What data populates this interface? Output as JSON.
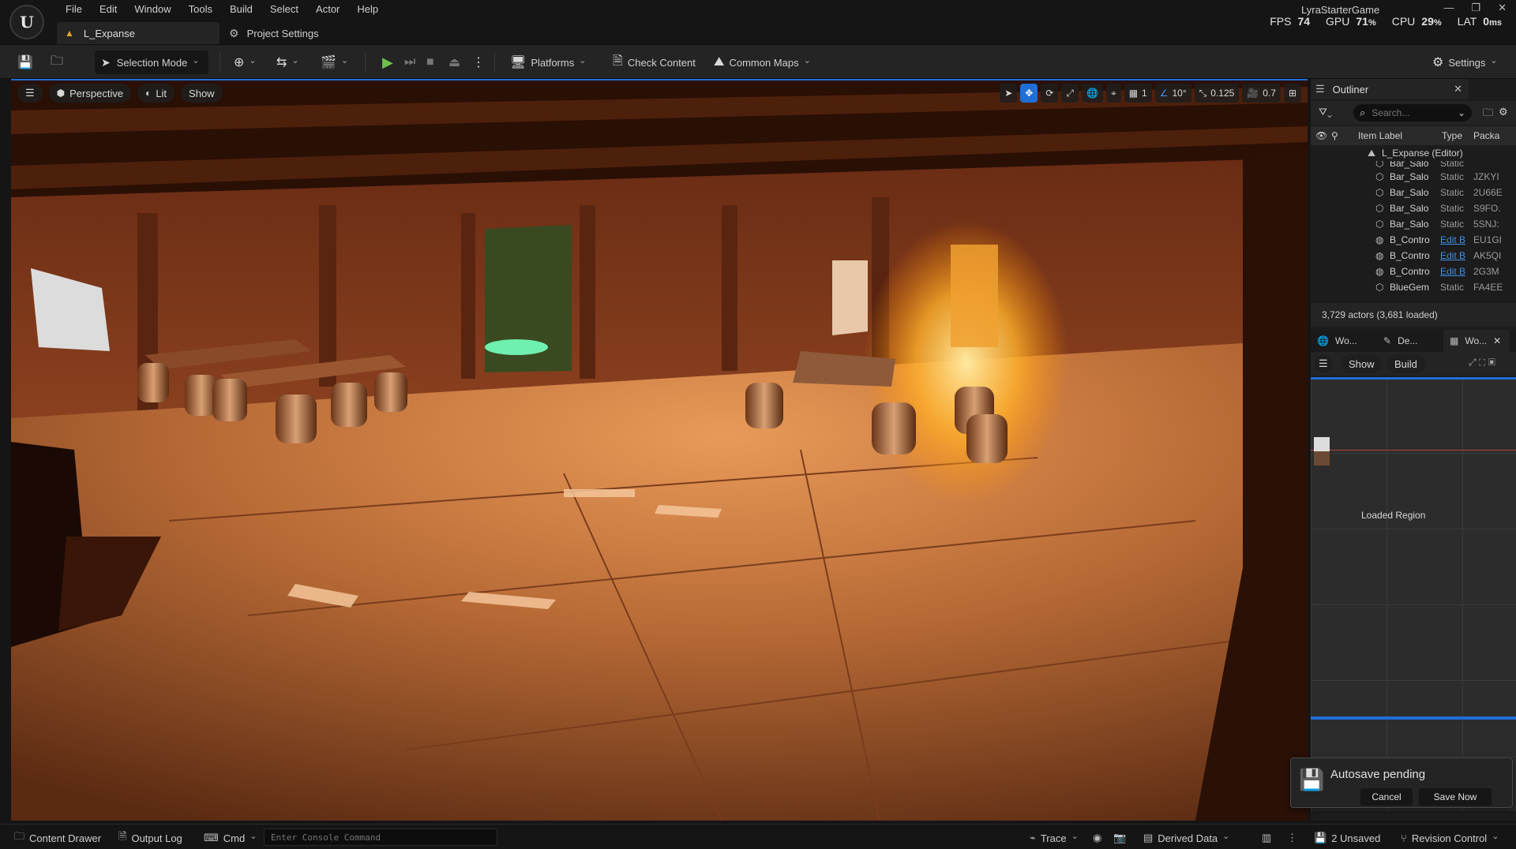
{
  "app": {
    "logo": "ue-logo",
    "project_name": "LyraStarterGame",
    "menus": [
      "File",
      "Edit",
      "Window",
      "Tools",
      "Build",
      "Select",
      "Actor",
      "Help"
    ],
    "doc_tab": "L_Expanse",
    "project_settings_tab": "Project Settings",
    "window_controls": [
      "—",
      "❐",
      "✕"
    ]
  },
  "perf": {
    "fps_label": "FPS",
    "fps_value": "74",
    "gpu_label": "GPU",
    "gpu_value": "71",
    "gpu_unit": "%",
    "cpu_label": "CPU",
    "cpu_value": "29",
    "cpu_unit": "%",
    "lat_label": "LAT",
    "lat_value": "0",
    "lat_unit": "ms"
  },
  "toolbar": {
    "selection_mode": "Selection Mode",
    "platforms": "Platforms",
    "check_content": "Check Content",
    "common_maps": "Common Maps",
    "settings": "Settings"
  },
  "viewport": {
    "perspective": "Perspective",
    "lit": "Lit",
    "show": "Show",
    "grid_snap": "1",
    "angle_snap": "10°",
    "scale_snap": "0.125",
    "camera_speed": "0.7"
  },
  "outliner": {
    "tab_title": "Outliner",
    "search_placeholder": "Search...",
    "columns": {
      "label": "Item Label",
      "type": "Type",
      "package": "Packa"
    },
    "root": "L_Expanse (Editor)",
    "rows": [
      {
        "label": "Bar_Salo",
        "type": "Static",
        "pkg": "",
        "icon": "static-mesh-icon",
        "partial": true
      },
      {
        "label": "Bar_Salo",
        "type": "Static",
        "pkg": "JZKYI",
        "icon": "static-mesh-icon"
      },
      {
        "label": "Bar_Salo",
        "type": "Static",
        "pkg": "2U66E",
        "icon": "static-mesh-icon"
      },
      {
        "label": "Bar_Salo",
        "type": "Static",
        "pkg": "S9FO.",
        "icon": "static-mesh-icon"
      },
      {
        "label": "Bar_Salo",
        "type": "Static",
        "pkg": "5SNJ:",
        "icon": "static-mesh-icon"
      },
      {
        "label": "B_Contro",
        "type": "Edit B",
        "pkg": "EU1GI",
        "icon": "blueprint-icon",
        "link": true
      },
      {
        "label": "B_Contro",
        "type": "Edit B",
        "pkg": "AK5QI",
        "icon": "blueprint-icon",
        "link": true
      },
      {
        "label": "B_Contro",
        "type": "Edit B",
        "pkg": "2G3M",
        "icon": "blueprint-icon",
        "link": true
      },
      {
        "label": "BlueGem",
        "type": "Static",
        "pkg": "FA4EE",
        "icon": "static-mesh-icon"
      }
    ],
    "status": "3,729 actors (3,681 loaded)"
  },
  "world_partition": {
    "tabs": [
      "Wo...",
      "De...",
      "Wo..."
    ],
    "show": "Show",
    "build": "Build",
    "region_label": "Loaded Region"
  },
  "autosave": {
    "title": "Autosave pending",
    "cancel": "Cancel",
    "save_now": "Save Now"
  },
  "statusbar": {
    "content_drawer": "Content Drawer",
    "output_log": "Output Log",
    "cmd": "Cmd",
    "console_placeholder": "Enter Console Command",
    "trace": "Trace",
    "derived_data": "Derived Data",
    "unsaved": "2 Unsaved",
    "revision_control": "Revision Control"
  },
  "colors": {
    "accent": "#1f6fd6",
    "play": "#6cc24a",
    "level_icon": "#e6a52a",
    "link": "#3e8fe8"
  }
}
